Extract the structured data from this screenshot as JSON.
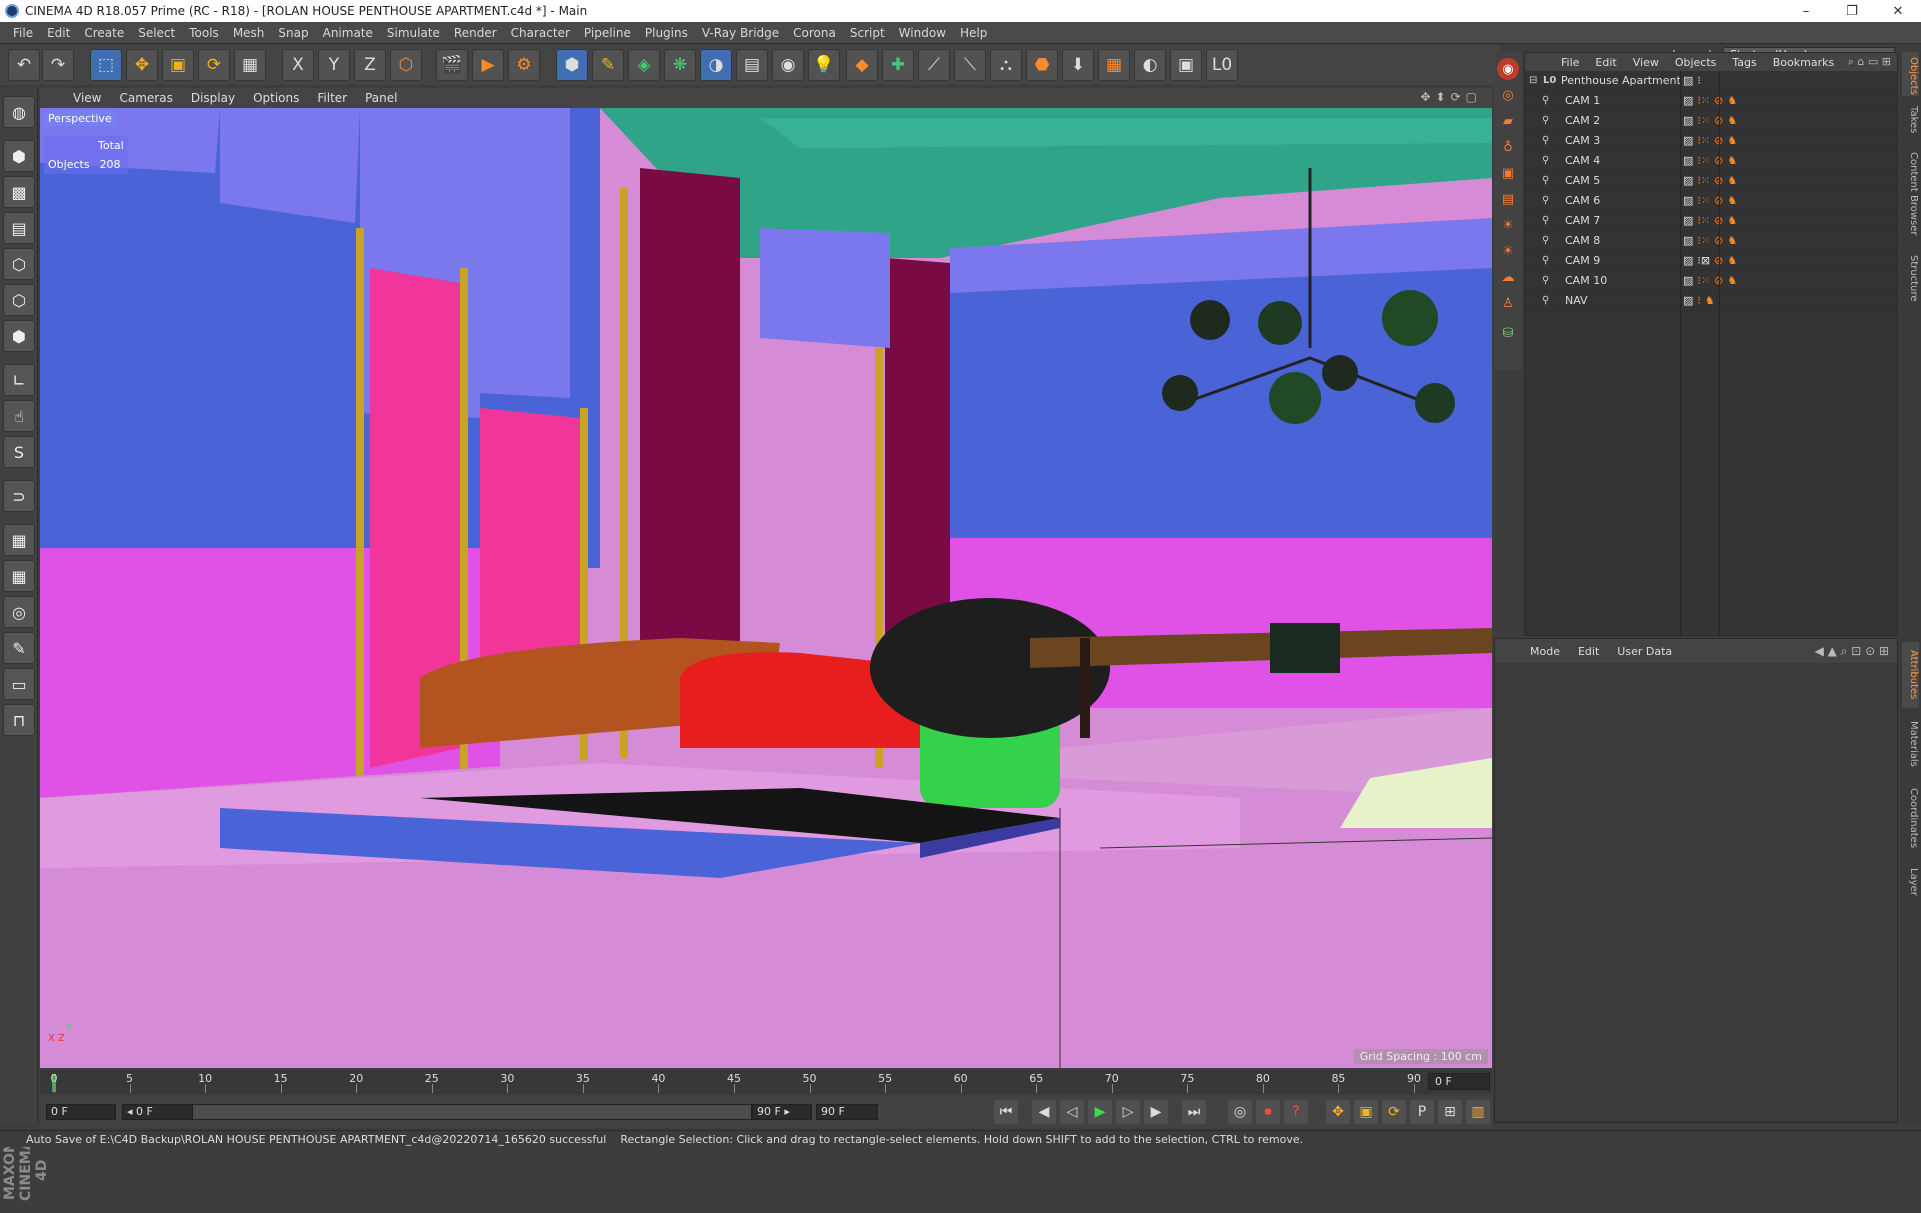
{
  "window": {
    "title": "CINEMA 4D R18.057 Prime (RC - R18) - [ROLAN HOUSE PENTHOUSE APARTMENT.c4d *] - Main",
    "minimize": "–",
    "restore": "❐",
    "close": "✕"
  },
  "menubar": [
    "File",
    "Edit",
    "Create",
    "Select",
    "Tools",
    "Mesh",
    "Snap",
    "Animate",
    "Simulate",
    "Render",
    "Character",
    "Pipeline",
    "Plugins",
    "V-Ray Bridge",
    "Corona",
    "Script",
    "Window",
    "Help"
  ],
  "layout": {
    "label": "Layout:",
    "value": "Startup (User)"
  },
  "toolbar": {
    "undo": "↶",
    "redo": "↷",
    "select": "⬚",
    "move": "✥",
    "scale": "▣",
    "rotate": "⟳",
    "recent": "▦",
    "x": "X",
    "y": "Y",
    "z": "Z",
    "coord": "⬡",
    "render_view": "🎬",
    "render": "▶",
    "render_settings": "⚙",
    "cube": "⬢",
    "pen": "✎",
    "subdiv": "◈",
    "array": "❋",
    "deform": "◑",
    "floor": "▤",
    "camera": "◉",
    "light": "💡",
    "tag1": "◆",
    "tag2": "✚",
    "tag3": "⟋",
    "tag4": "⟍",
    "tag5": "⛬",
    "tag6": "⬣",
    "tag7": "⬇",
    "tag8": "▦",
    "tag9": "◐",
    "tag10": "▣",
    "tag11": "L0"
  },
  "viewport_menu": [
    "View",
    "Cameras",
    "Display",
    "Options",
    "Filter",
    "Panel"
  ],
  "viewport_icons": "✥⬍⟳▢",
  "viewport": {
    "label": "Perspective",
    "stats_total_label": "Total",
    "stats_objects_label": "Objects",
    "stats_objects_value": "208",
    "grid_spacing": "Grid Spacing : 100 cm",
    "axis_y": "Y",
    "axis_xz": "X  Z"
  },
  "object_manager": {
    "menu": [
      "File",
      "Edit",
      "View",
      "Objects",
      "Tags",
      "Bookmarks"
    ],
    "root": "Penthouse Apartment",
    "root_icon": "L0",
    "objects": [
      "CAM 1",
      "CAM 2",
      "CAM 3",
      "CAM 4",
      "CAM 5",
      "CAM 6",
      "CAM 7",
      "CAM 8",
      "CAM 9",
      "CAM 10",
      "NAV"
    ]
  },
  "attribute_manager": {
    "menu": [
      "Mode",
      "Edit",
      "User Data"
    ]
  },
  "side_tabs": {
    "top": [
      "Objects",
      "Takes",
      "Content Browser",
      "Structure"
    ],
    "bottom": [
      "Attributes",
      "Materials",
      "Coordinates",
      "Layer"
    ]
  },
  "timeline": {
    "ticks": [
      "0",
      "5",
      "10",
      "15",
      "20",
      "25",
      "30",
      "35",
      "40",
      "45",
      "50",
      "55",
      "60",
      "65",
      "70",
      "75",
      "80",
      "85",
      "90"
    ],
    "current_frame": "0 F"
  },
  "transport": {
    "start_field": "0 F",
    "range_start": "◂ 0 F",
    "range_end": "90 F ▸",
    "end_field": "90 F",
    "buttons": {
      "first": "⏮",
      "prev_key": "◀",
      "prev": "◁",
      "play": "▶",
      "next": "▷",
      "next_key": "▶",
      "last": "⏭"
    }
  },
  "status": {
    "left": "Auto Save of E:\\C4D Backup\\ROLAN HOUSE PENTHOUSE APARTMENT_c4d@20220714_165620 successful",
    "right": "Rectangle Selection: Click and drag to rectangle-select elements. Hold down SHIFT to add to the selection, CTRL to remove."
  },
  "colors": {
    "accent_orange": "#ff8a20",
    "viewport_pink": "#d68bd6",
    "viewport_blue": "#6f68e0",
    "viewport_magenta": "#e040c8"
  },
  "maxon_logo": "MAXON CINEMA 4D"
}
